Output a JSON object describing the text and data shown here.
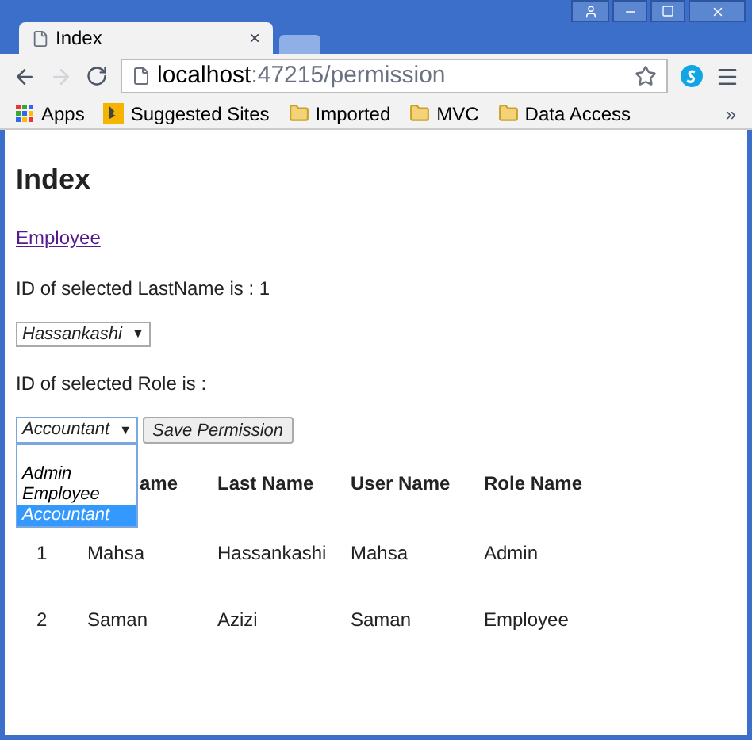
{
  "browser": {
    "tab_title": "Index",
    "tab_close": "×",
    "address": {
      "host": "localhost",
      "rest": ":47215/permission"
    },
    "bookmarks": [
      {
        "label": "Apps",
        "kind": "apps"
      },
      {
        "label": "Suggested Sites",
        "kind": "bing"
      },
      {
        "label": "Imported",
        "kind": "folder"
      },
      {
        "label": "MVC",
        "kind": "folder"
      },
      {
        "label": "Data Access",
        "kind": "folder"
      }
    ],
    "more": "»"
  },
  "page": {
    "heading": "Index",
    "link": "Employee",
    "lastname_text": "ID of selected LastName is : 1",
    "lastname_select": "Hassankashi",
    "select_arrow": "▼",
    "role_text": "ID of selected Role is :",
    "role_select": "Accountant",
    "role_arrow": "▼",
    "save_button": "Save Permission",
    "role_options": [
      {
        "label": "Admin",
        "selected": false
      },
      {
        "label": "Employee",
        "selected": false
      },
      {
        "label": "Accountant",
        "selected": true
      }
    ],
    "table": {
      "columns": [
        "",
        "ame",
        "Last Name",
        "User Name",
        "Role Name"
      ],
      "rows": [
        [
          "1",
          "Mahsa",
          "Hassankashi",
          "Mahsa",
          "Admin"
        ],
        [
          "2",
          "Saman",
          "Azizi",
          "Saman",
          "Employee"
        ]
      ]
    }
  }
}
